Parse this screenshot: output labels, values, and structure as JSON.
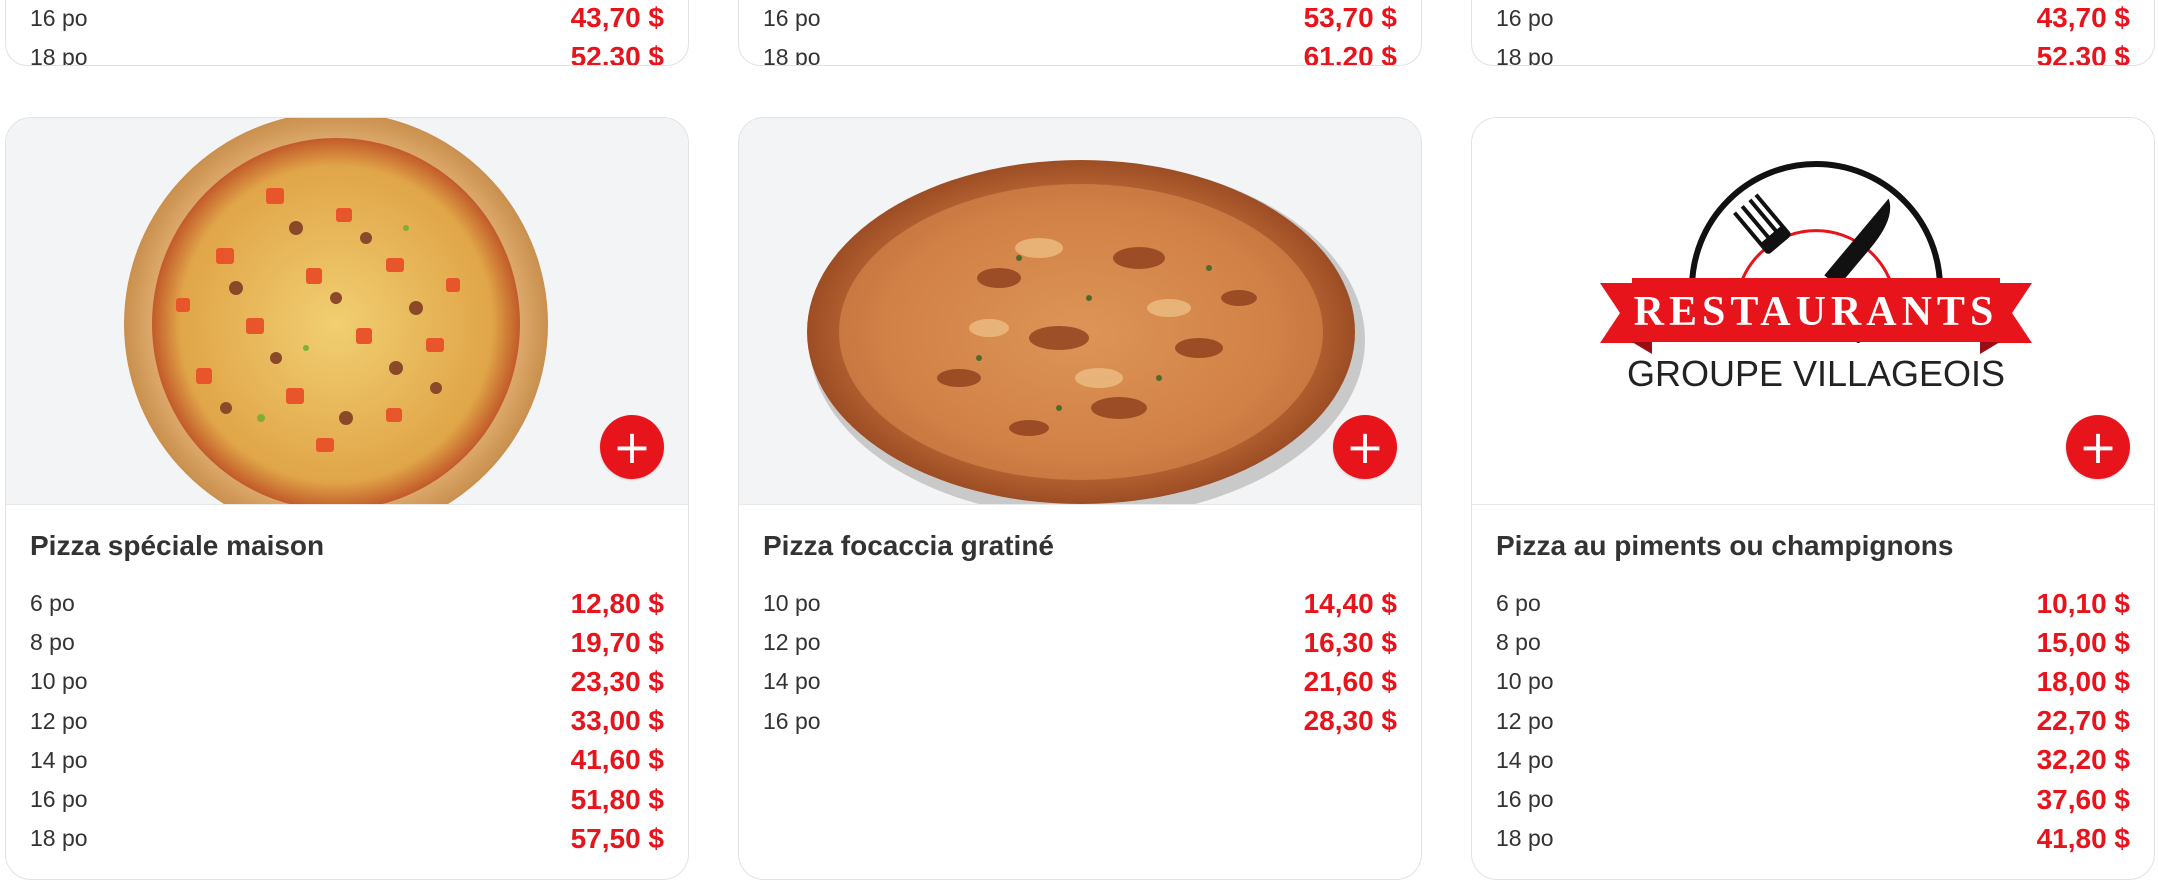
{
  "colors": {
    "accent": "#e8141c",
    "text": "#333333",
    "border": "#e2e2e2"
  },
  "add_icon": "plus-icon",
  "top_cards": [
    {
      "rows": [
        {
          "size": "16 po",
          "price": "43,70 $"
        },
        {
          "size": "18 po",
          "price": "52,30 $"
        }
      ]
    },
    {
      "rows": [
        {
          "size": "16 po",
          "price": "53,70 $"
        },
        {
          "size": "18 po",
          "price": "61,20 $"
        }
      ]
    },
    {
      "rows": [
        {
          "size": "16 po",
          "price": "43,70 $"
        },
        {
          "size": "18 po",
          "price": "52,30 $"
        }
      ]
    }
  ],
  "cards": [
    {
      "title": "Pizza spéciale maison",
      "add_label": "+",
      "rows": [
        {
          "size": "6 po",
          "price": "12,80 $"
        },
        {
          "size": "8 po",
          "price": "19,70 $"
        },
        {
          "size": "10 po",
          "price": "23,30 $"
        },
        {
          "size": "12 po",
          "price": "33,00 $"
        },
        {
          "size": "14 po",
          "price": "41,60 $"
        },
        {
          "size": "16 po",
          "price": "51,80 $"
        },
        {
          "size": "18 po",
          "price": "57,50 $"
        }
      ]
    },
    {
      "title": "Pizza focaccia gratiné",
      "add_label": "+",
      "rows": [
        {
          "size": "10 po",
          "price": "14,40 $"
        },
        {
          "size": "12 po",
          "price": "16,30 $"
        },
        {
          "size": "14 po",
          "price": "21,60 $"
        },
        {
          "size": "16 po",
          "price": "28,30 $"
        }
      ]
    },
    {
      "title": "Pizza au piments ou champignons",
      "add_label": "+",
      "logo": {
        "banner": "RESTAURANTS",
        "subtitle": "GROUPE VILLAGEOIS"
      },
      "rows": [
        {
          "size": "6 po",
          "price": "10,10 $"
        },
        {
          "size": "8 po",
          "price": "15,00 $"
        },
        {
          "size": "10 po",
          "price": "18,00 $"
        },
        {
          "size": "12 po",
          "price": "22,70 $"
        },
        {
          "size": "14 po",
          "price": "32,20 $"
        },
        {
          "size": "16 po",
          "price": "37,60 $"
        },
        {
          "size": "18 po",
          "price": "41,80 $"
        }
      ]
    }
  ]
}
